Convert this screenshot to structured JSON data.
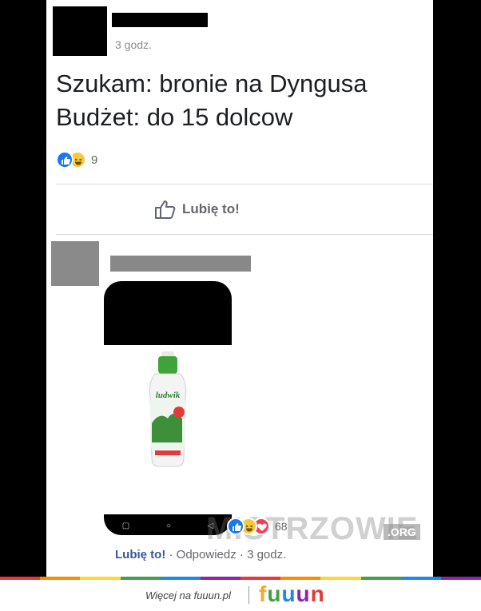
{
  "post": {
    "timestamp": "3 godz.",
    "text": "Szukam: bronie na Dyngusa\nBudżet: do 15 dolcow",
    "reaction_count": "9",
    "like_label": "Lubię to!"
  },
  "comment": {
    "reaction_count": "68",
    "like_label": "Lubię to!",
    "sep1": " · ",
    "reply_label": "Odpowiedz",
    "sep2": " · ",
    "timestamp": "3 godz.",
    "product_label": "ludwik"
  },
  "watermark": {
    "text": "MISTRZOWIE",
    "suffix": ".ORG"
  },
  "footer": {
    "text": "Więcej na fuuun.pl",
    "logo": "fuuun"
  },
  "colors": {
    "fb_blue": "#1877f2",
    "haha_yellow": "#f7c83d",
    "love_red": "#f33e58",
    "link_blue": "#385898"
  },
  "icons": [
    "like-icon",
    "haha-icon",
    "love-icon",
    "thumbs-up-outline-icon",
    "back-nav-icon",
    "home-nav-icon",
    "recent-nav-icon"
  ]
}
